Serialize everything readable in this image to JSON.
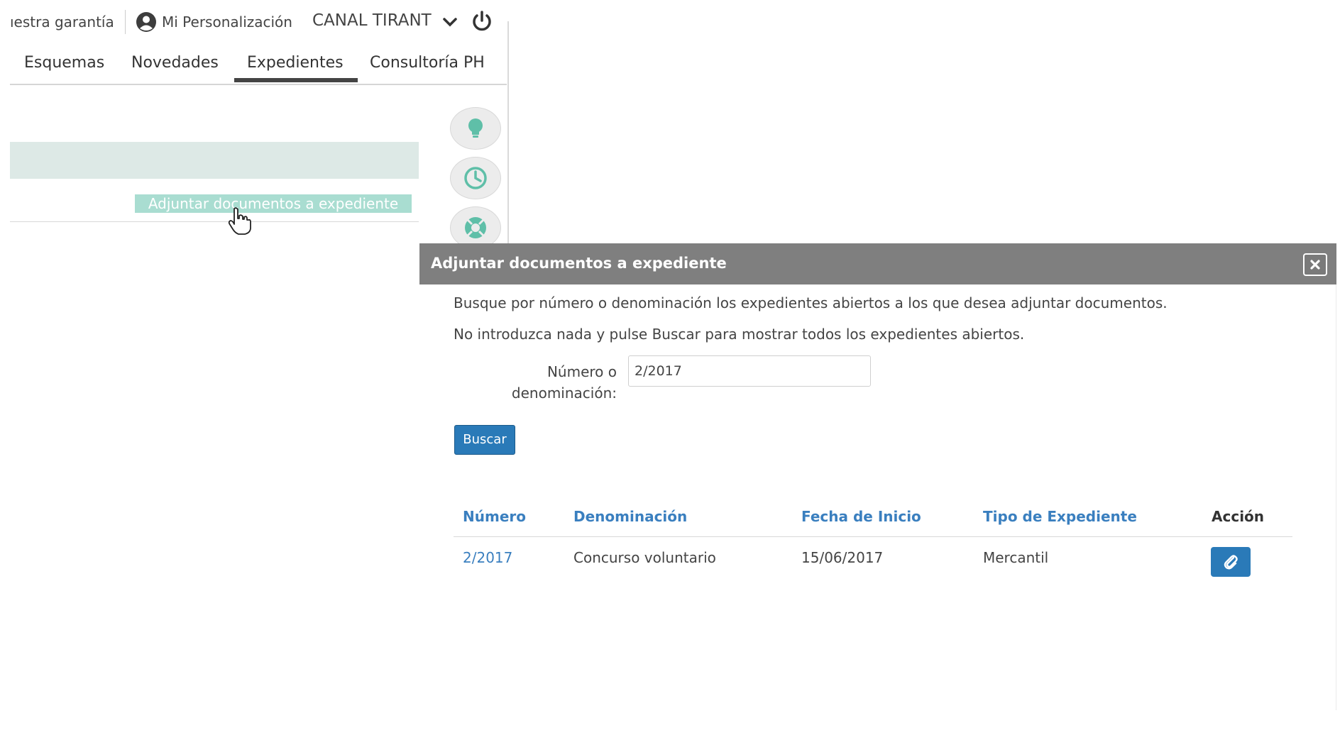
{
  "topbar": {
    "garantia": "ıestra garantía",
    "personalizacion": "Mi Personalización",
    "canal": "CANAL TIRANT"
  },
  "nav": {
    "tabs": [
      "Esquemas",
      "Novedades",
      "Expedientes",
      "Consultoría PH"
    ],
    "active": "Expedientes"
  },
  "page": {
    "attach_link": "Adjuntar documentos a expediente"
  },
  "modal": {
    "title": "Adjuntar documentos a expediente",
    "instructions": [
      "Busque por número o denominación los expedientes abiertos a los que desea adjuntar documentos.",
      "No introduzca nada y pulse Buscar para mostrar todos los expedientes abiertos."
    ],
    "field_label_line1": "Número o",
    "field_label_line2": "denominación:",
    "field_value": "2/2017",
    "search_button": "Buscar",
    "table": {
      "headers": [
        "Número",
        "Denominación",
        "Fecha de Inicio",
        "Tipo de Expediente",
        "Acción"
      ],
      "rows": [
        [
          "2/2017",
          "Concurso voluntario",
          "15/06/2017",
          "Mercantil"
        ]
      ]
    }
  },
  "icons": {
    "person": "user-circle-icon",
    "chevron": "chevron-down-icon",
    "power": "power-icon",
    "tip": "lightbulb-icon",
    "history": "clock-icon",
    "support": "lifebuoy-icon",
    "close": "close-icon",
    "attach": "paperclip-icon"
  },
  "colors": {
    "accent_blue": "#2a7ab8",
    "link_blue": "#3a7fbf",
    "teal_icon": "#5fbfa8",
    "modal_header": "#7f7f7f"
  }
}
